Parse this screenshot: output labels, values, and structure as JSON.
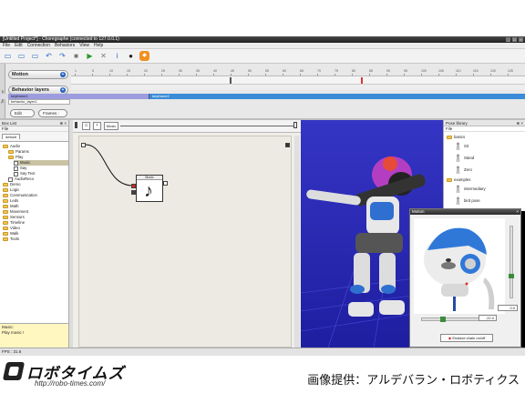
{
  "window": {
    "title": "[Untitled Project*] - Choregraphe (connected to 127.0.0.1)"
  },
  "menu": [
    "File",
    "Edit",
    "Connection",
    "Behaviors",
    "View",
    "Help"
  ],
  "toolbar": {
    "icons": [
      "new-icon",
      "open-icon",
      "save-icon",
      "undo-icon",
      "redo-icon",
      "stop-icon",
      "play-icon",
      "close-icon",
      "info-icon",
      "record-icon",
      "orange-tool-icon"
    ],
    "glyphs": [
      "▭",
      "▭",
      "▭",
      "↶",
      "↷",
      "■",
      "▶",
      "✕",
      "i",
      "●",
      "◆"
    ]
  },
  "timeline": {
    "side_tab": "Timeline",
    "motion_label": "Motion",
    "behavior_layers_label": "Behavior layers",
    "layer_name": "behavior_layer1",
    "edit_button": "Edit",
    "frames_label": "Frames : 10",
    "ruler_ticks": [
      "1",
      "5",
      "10",
      "15",
      "20",
      "25",
      "30",
      "35",
      "40",
      "45",
      "50",
      "55",
      "60",
      "65",
      "70",
      "75",
      "80",
      "85",
      "90",
      "95",
      "100",
      "105",
      "110",
      "115",
      "120",
      "125"
    ],
    "keyframes": [
      "keyframe1",
      "keyframe2"
    ]
  },
  "box_list": {
    "title": "Box List",
    "file": "File",
    "tab": "default",
    "tree": [
      {
        "label": "Audio",
        "indent": 0,
        "kind": "folder"
      },
      {
        "label": "Params",
        "indent": 1,
        "kind": "folder"
      },
      {
        "label": "Play",
        "indent": 1,
        "kind": "folder"
      },
      {
        "label": "Music",
        "indent": 2,
        "kind": "box",
        "selected": true
      },
      {
        "label": "Say",
        "indent": 2,
        "kind": "box"
      },
      {
        "label": "Say Text",
        "indent": 2,
        "kind": "box"
      },
      {
        "label": "AudioReco",
        "indent": 1,
        "kind": "box"
      },
      {
        "label": "Demo",
        "indent": 0,
        "kind": "folder"
      },
      {
        "label": "Logic",
        "indent": 0,
        "kind": "folder"
      },
      {
        "label": "Communication",
        "indent": 0,
        "kind": "folder"
      },
      {
        "label": "Leds",
        "indent": 0,
        "kind": "folder"
      },
      {
        "label": "Math",
        "indent": 0,
        "kind": "folder"
      },
      {
        "label": "Movement",
        "indent": 0,
        "kind": "folder"
      },
      {
        "label": "Sensors",
        "indent": 0,
        "kind": "folder"
      },
      {
        "label": "Timeline",
        "indent": 0,
        "kind": "folder"
      },
      {
        "label": "Video",
        "indent": 0,
        "kind": "folder"
      },
      {
        "label": "Walk",
        "indent": 0,
        "kind": "folder"
      },
      {
        "label": "Tools",
        "indent": 0,
        "kind": "folder"
      }
    ],
    "description_title": "Music:",
    "description_body": "Play music !"
  },
  "flow": {
    "breadcrumb": "Music",
    "box_title": "Music",
    "note_glyph": "♪"
  },
  "pose_library": {
    "title": "Pose library",
    "file": "File",
    "tree": [
      {
        "label": "basics",
        "kind": "folder",
        "indent": 0
      },
      {
        "label": "Sit",
        "kind": "pose",
        "indent": 1
      },
      {
        "label": "Stand",
        "kind": "pose",
        "indent": 1
      },
      {
        "label": "Zero",
        "kind": "pose",
        "indent": 1
      },
      {
        "label": "examples",
        "kind": "folder",
        "indent": 0
      },
      {
        "label": "intermediary",
        "kind": "pose",
        "indent": 1
      },
      {
        "label": "bird pose",
        "kind": "pose",
        "indent": 1
      }
    ]
  },
  "motion_dialog": {
    "title": "Motion",
    "pitch_value": "0.0",
    "yaw_value": "-22.0",
    "enslave_button": "Enslave chain on/off"
  },
  "status": {
    "fps": "FPS : 31.6"
  },
  "banner": {
    "logo_text": "ロボタイムズ",
    "logo_url": "http://robo-times.com/",
    "credit": "画像提供：アルデバラン・ロボティクス"
  },
  "colors": {
    "view_bg": "#2a2ab8",
    "accent": "#2260c0",
    "keyframe2": "#3a8bd8"
  }
}
